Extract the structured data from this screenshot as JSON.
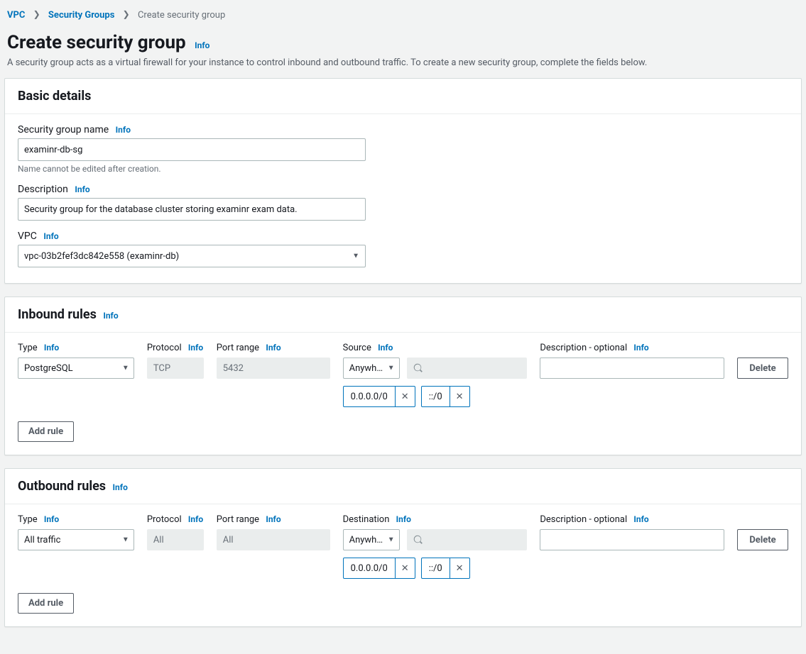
{
  "breadcrumb": {
    "vpc": "VPC",
    "sg": "Security Groups",
    "current": "Create security group"
  },
  "page": {
    "title": "Create security group",
    "info": "Info",
    "desc": "A security group acts as a virtual firewall for your instance to control inbound and outbound traffic. To create a new security group, complete the fields below."
  },
  "basic": {
    "heading": "Basic details",
    "name_label": "Security group name",
    "name_value": "examinr-db-sg",
    "name_help": "Name cannot be edited after creation.",
    "desc_label": "Description",
    "desc_value": "Security group for the database cluster storing examinr exam data.",
    "vpc_label": "VPC",
    "vpc_value": "vpc-03b2fef3dc842e558 (examinr-db)"
  },
  "common": {
    "info": "Info",
    "type": "Type",
    "protocol": "Protocol",
    "port_range": "Port range",
    "source": "Source",
    "destination": "Destination",
    "desc_opt": "Description - optional",
    "delete": "Delete",
    "add_rule": "Add rule",
    "anywhere": "Anywh…",
    "chip1": "0.0.0.0/0",
    "chip2": "::/0"
  },
  "inbound": {
    "heading": "Inbound rules",
    "type": "PostgreSQL",
    "protocol": "TCP",
    "port": "5432"
  },
  "outbound": {
    "heading": "Outbound rules",
    "type": "All traffic",
    "protocol": "All",
    "port": "All"
  }
}
